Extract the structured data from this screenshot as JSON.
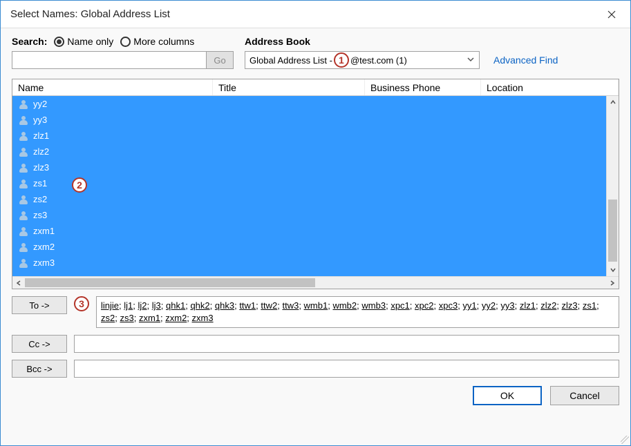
{
  "window": {
    "title": "Select Names: Global Address List"
  },
  "search": {
    "label": "Search:",
    "opt_name_only": "Name only",
    "opt_more_cols": "More columns",
    "go_label": "Go"
  },
  "address_book": {
    "label": "Address Book",
    "selected_prefix": "Global Address List - ",
    "selected_suffix": "@test.com (1)",
    "advanced_find": "Advanced Find"
  },
  "columns": {
    "name": "Name",
    "title": "Title",
    "phone": "Business Phone",
    "location": "Location"
  },
  "list": [
    "yy2",
    "yy3",
    "zlz1",
    "zlz2",
    "zlz3",
    "zs1",
    "zs2",
    "zs3",
    "zxm1",
    "zxm2",
    "zxm3"
  ],
  "recipients": {
    "to_label": "To ->",
    "cc_label": "Cc ->",
    "bcc_label": "Bcc ->",
    "to_list": [
      "linjie",
      "lj1",
      "lj2",
      "lj3",
      "qhk1",
      "qhk2",
      "qhk3",
      "ttw1",
      "ttw2",
      "ttw3",
      "wmb1",
      "wmb2",
      "wmb3",
      "xpc1",
      "xpc2",
      "xpc3",
      "yy1",
      "yy2",
      "yy3",
      "zlz1",
      "zlz2",
      "zlz3",
      "zs1",
      "zs2",
      "zs3",
      "zxm1",
      "zxm2",
      "zxm3"
    ]
  },
  "buttons": {
    "ok": "OK",
    "cancel": "Cancel"
  },
  "annotations": {
    "a1": "1",
    "a2": "2",
    "a3": "3"
  }
}
